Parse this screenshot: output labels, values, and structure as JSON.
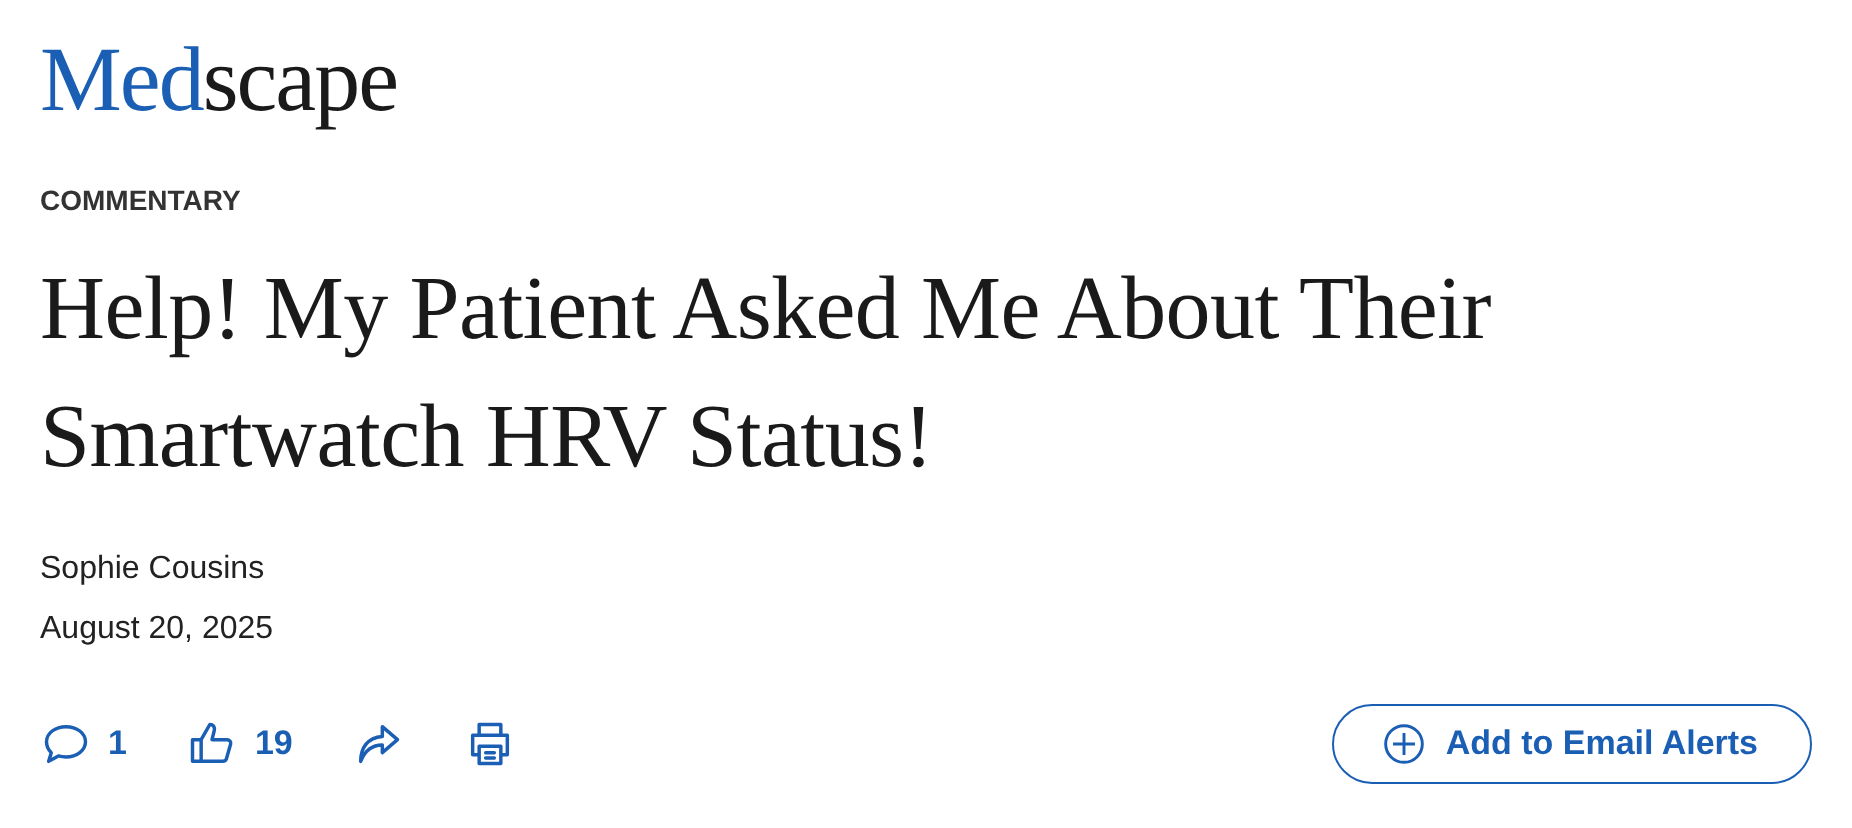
{
  "logo": {
    "accent": "Med",
    "rest": "scape"
  },
  "category": "COMMENTARY",
  "headline": "Help! My Patient Asked Me About Their Smartwatch HRV Status!",
  "author": "Sophie Cousins",
  "date": "August 20, 2025",
  "actions": [
    {
      "kind": "comments",
      "count": "1"
    },
    {
      "kind": "likes",
      "count": "19"
    },
    {
      "kind": "share"
    },
    {
      "kind": "print"
    }
  ],
  "alert_button": "Add to Email Alerts"
}
